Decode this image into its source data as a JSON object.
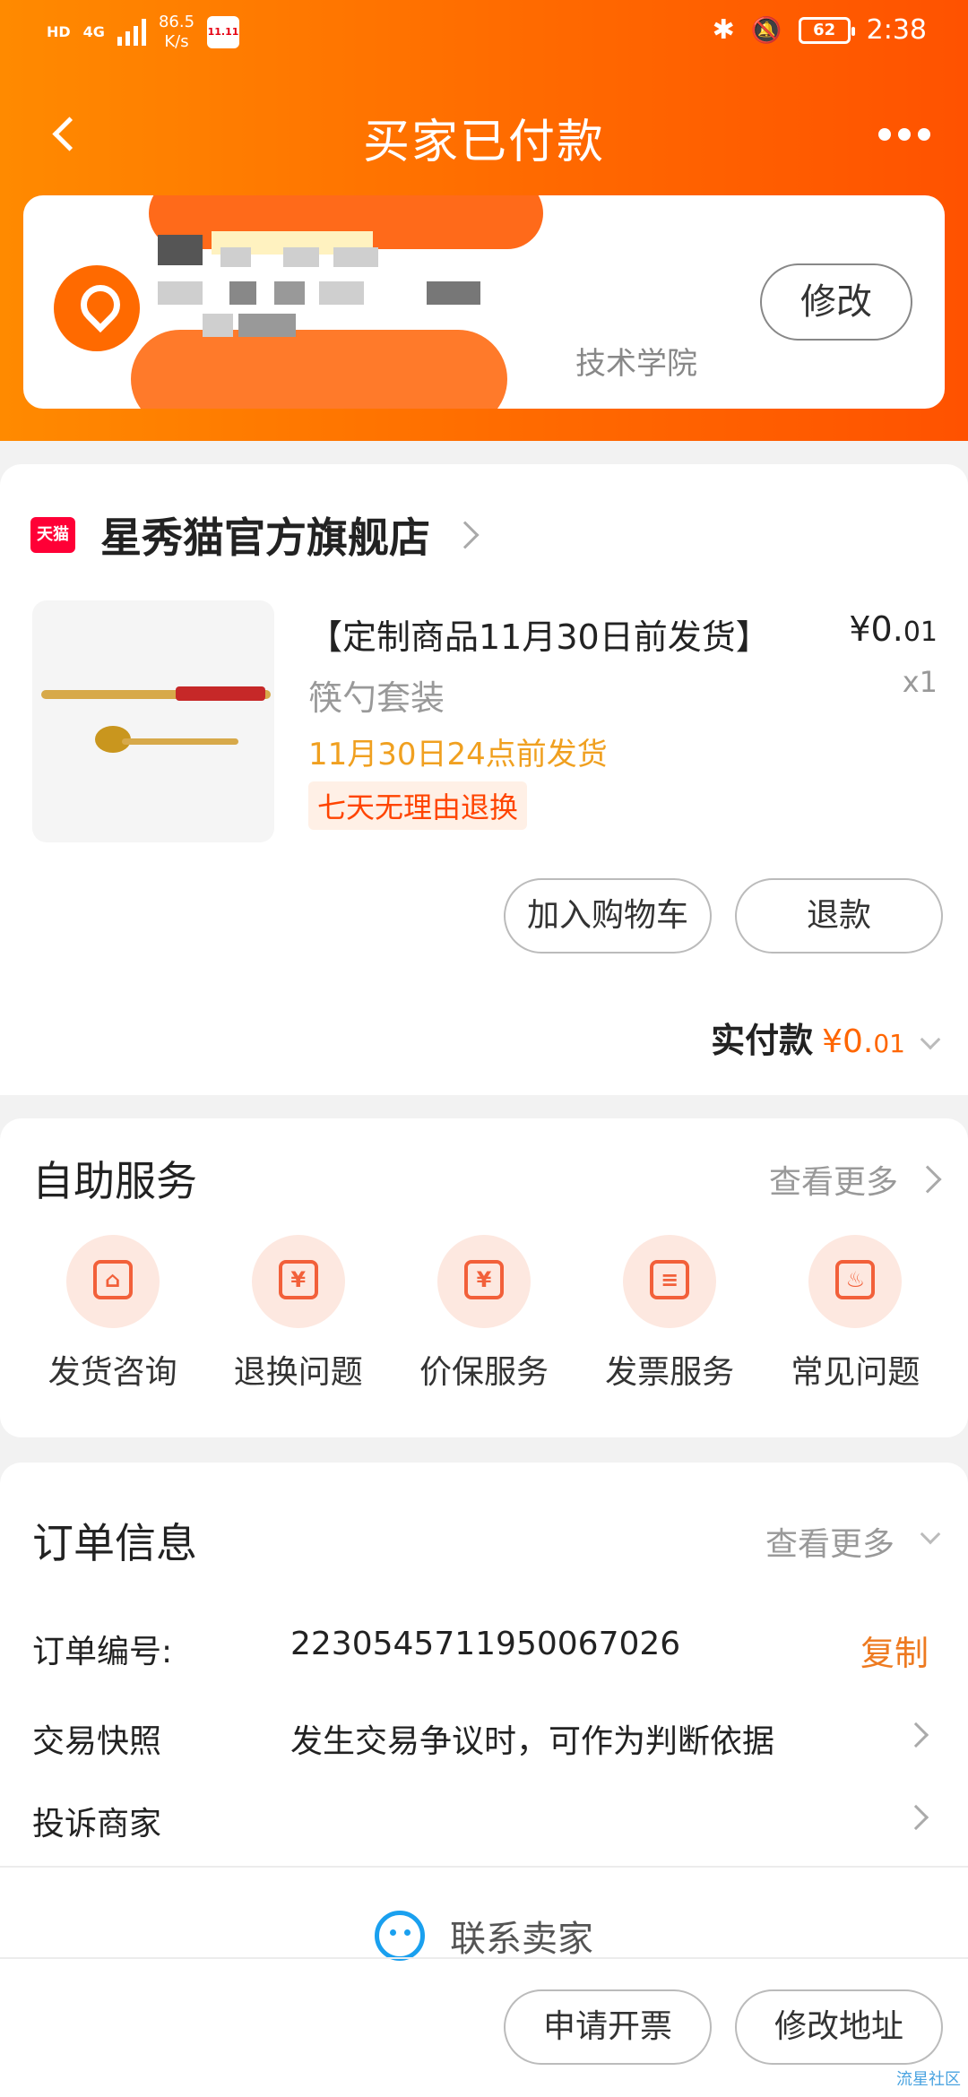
{
  "status_bar": {
    "network_hd": "HD",
    "network_4g": "4G",
    "speed_value": "86.5",
    "speed_unit": "K/s",
    "event_badge": "11.11",
    "battery": "62",
    "time": "2:38"
  },
  "nav": {
    "title": "买家已付款"
  },
  "address": {
    "visible_fragment": "技术学院",
    "edit_label": "修改"
  },
  "shop": {
    "badge": "天猫",
    "name": "星秀猫官方旗舰店"
  },
  "product": {
    "title": "【定制商品11月30日前发货】",
    "price_main": "¥0.",
    "price_cents": "01",
    "sku": "筷勺套装",
    "qty": "x1",
    "ship_note": "11月30日24点前发货",
    "tag": "七天无理由退换"
  },
  "order_actions": {
    "add_cart": "加入购物车",
    "refund": "退款"
  },
  "payment": {
    "label": "实付款",
    "amount_main": "¥0.",
    "amount_cents": "01"
  },
  "self_service": {
    "title": "自助服务",
    "more": "查看更多",
    "items": [
      {
        "label": "发货咨询",
        "icon": "shipping-box-icon",
        "glyph": "⌂"
      },
      {
        "label": "退换问题",
        "icon": "yuan-return-icon",
        "glyph": "¥"
      },
      {
        "label": "价保服务",
        "icon": "price-protect-icon",
        "glyph": "¥"
      },
      {
        "label": "发票服务",
        "icon": "invoice-icon",
        "glyph": "≡"
      },
      {
        "label": "常见问题",
        "icon": "flame-icon",
        "glyph": "♨"
      }
    ]
  },
  "order_info": {
    "title": "订单信息",
    "more": "查看更多",
    "order_no_label": "订单编号:",
    "order_no": "2230545711950067026",
    "copy": "复制",
    "snapshot_label": "交易快照",
    "snapshot_value": "发生交易争议时，可作为判断依据",
    "complain_label": "投诉商家"
  },
  "contact": {
    "label": "联系卖家"
  },
  "bottom": {
    "invoice": "申请开票",
    "change_address": "修改地址"
  },
  "watermark": "流星社区",
  "colors": {
    "header_start": "#ff8a00",
    "header_end": "#ff5200",
    "accent_orange": "#ff6600",
    "link_orange": "#ee7a20",
    "contact_blue": "#1aa0ef"
  }
}
